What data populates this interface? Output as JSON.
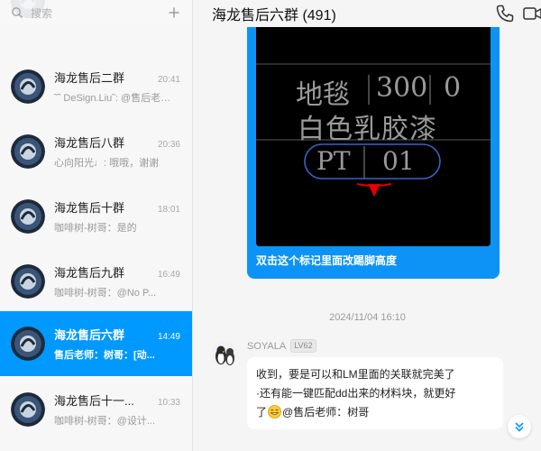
{
  "search": {
    "placeholder": "搜索"
  },
  "conversations": [
    {
      "name": "海龙售后二群",
      "time": "20:41",
      "preview": "˜˜ DeSign.Liu˜: @售后老师：树哥"
    },
    {
      "name": "海龙售后八群",
      "time": "20:36",
      "preview": "心向阳光♩: 哦哦，谢谢"
    },
    {
      "name": "海龙售后十群",
      "time": "18:01",
      "preview": "咖啡树-树哥：是的"
    },
    {
      "name": "海龙售后九群",
      "time": "16:49",
      "preview": "咖啡树-树哥：@No P..."
    },
    {
      "name": "海龙售后六群",
      "time": "14:49",
      "preview": "售后老师：树哥：[动...",
      "active": true
    },
    {
      "name": "海龙售后十一...",
      "time": "10:33",
      "preview": "咖啡树-树哥：@设计..."
    }
  ],
  "chat": {
    "title": "海龙售后六群 (491)",
    "image_caption": "双击这个标记里面改踢脚高度",
    "cad_text": {
      "line1_a": "地毯",
      "line1_b": "300",
      "line1_c": "0",
      "line2": "白色乳胶漆",
      "tag_left": "PT",
      "tag_right": "01"
    },
    "timestamp": "2024/11/04 16:10",
    "message": {
      "sender": "SOYALA",
      "level": "LV62",
      "line1": "收到，要是可以和LM里面的关联就完美了",
      "line2": "·还有能一键匹配dd出来的材料块，就更好",
      "line3_pre": "了",
      "line3_post": "@售后老师：树哥"
    }
  },
  "colors": {
    "accent": "#0099ff",
    "bubble": "#0d93f5"
  }
}
